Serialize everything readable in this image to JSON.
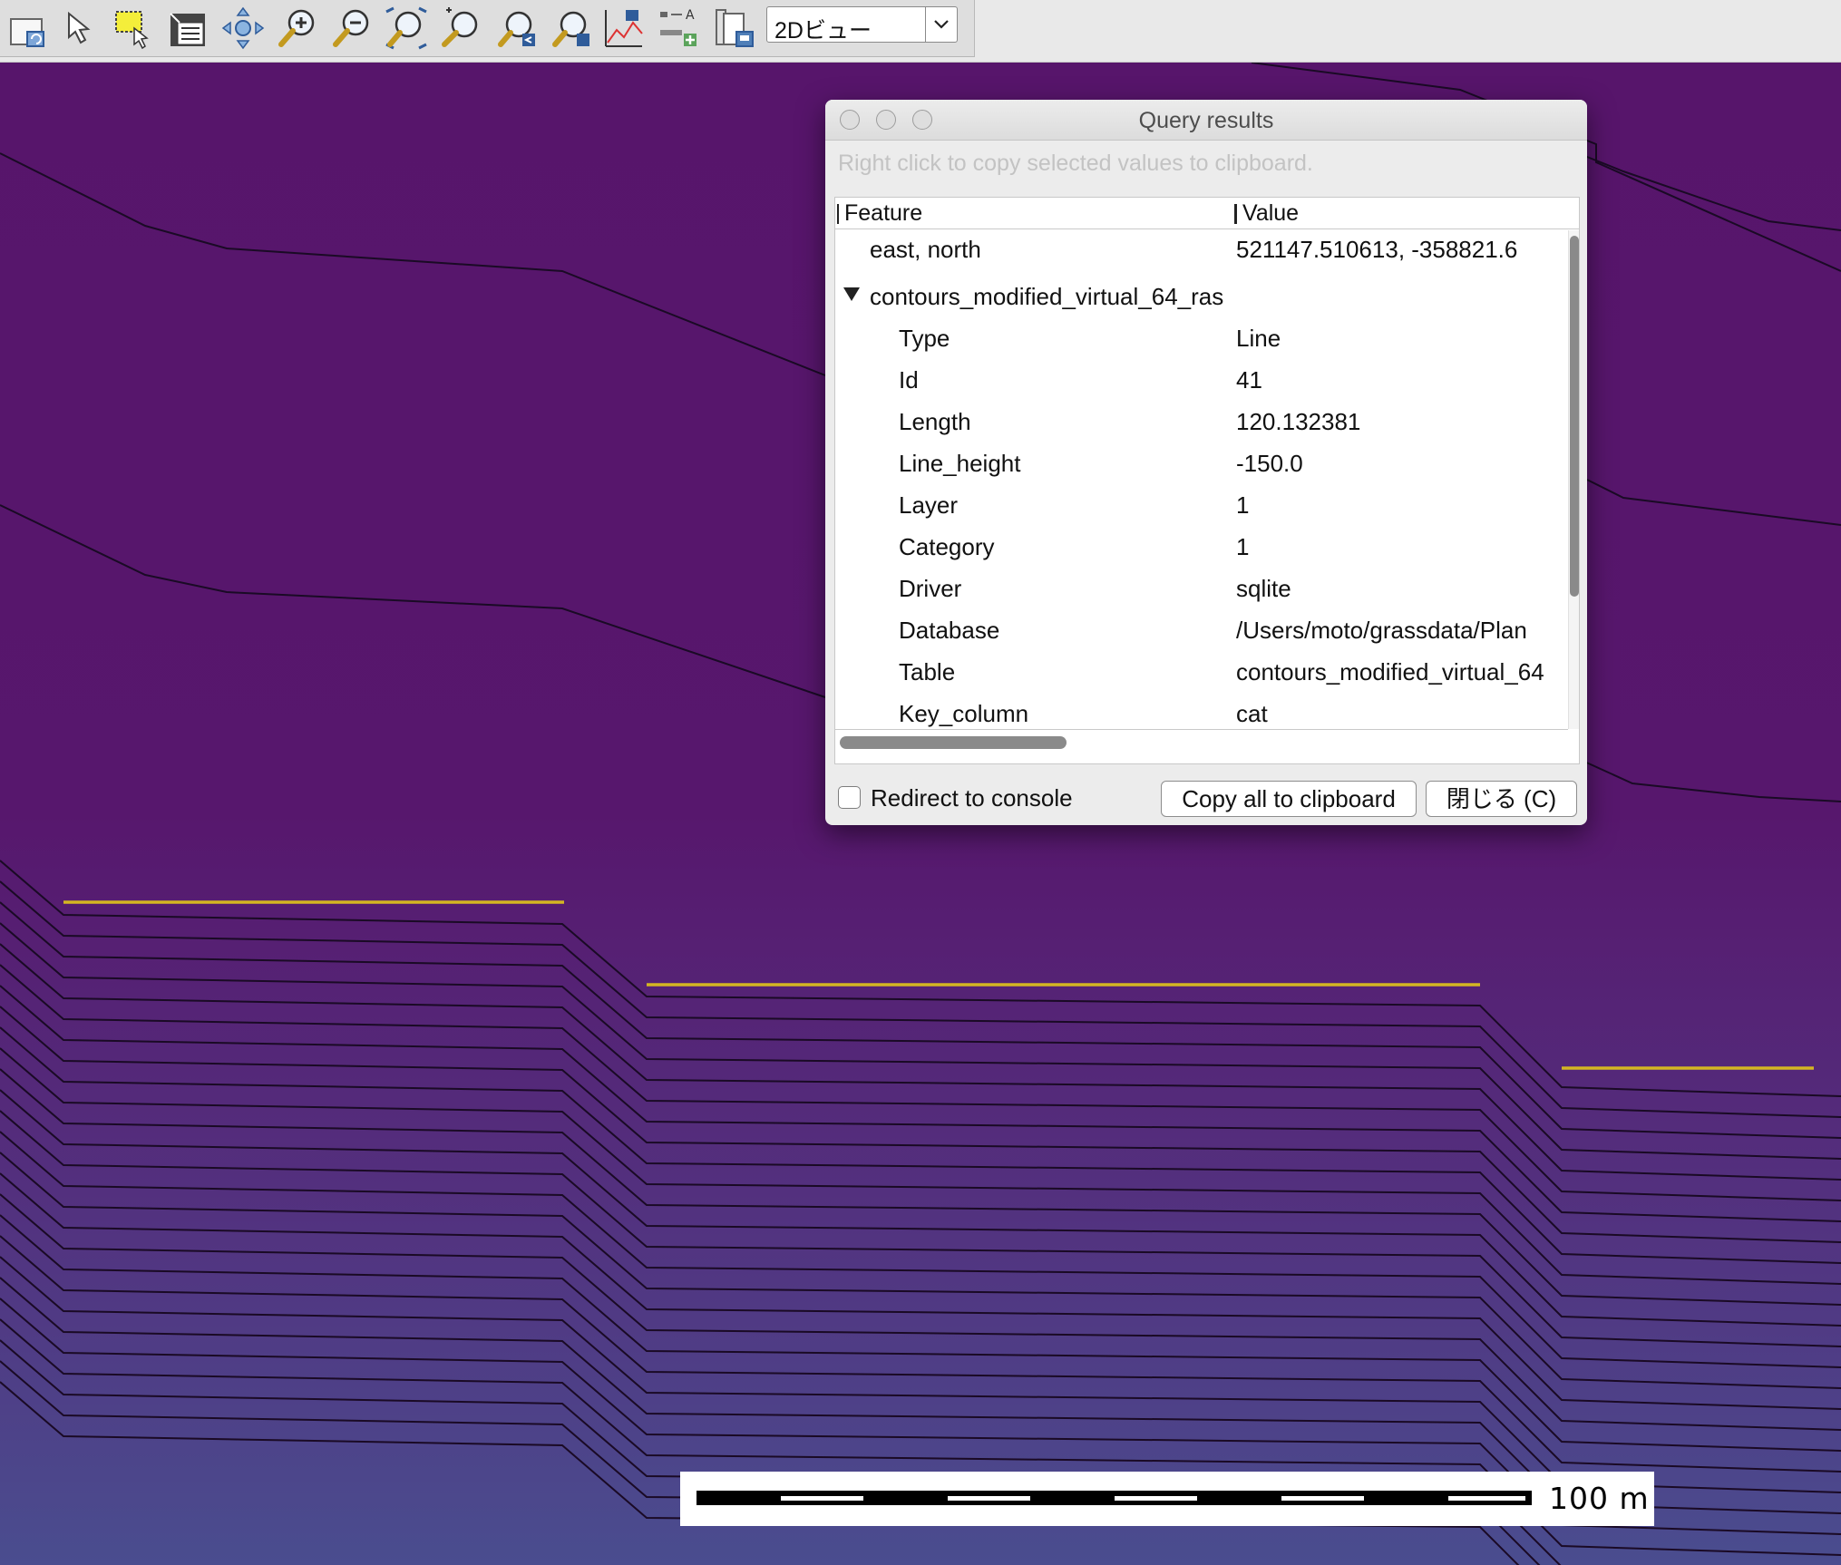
{
  "toolbar": {
    "tools": [
      {
        "name": "display-map-icon"
      },
      {
        "name": "pointer-icon"
      },
      {
        "name": "select-features-icon"
      },
      {
        "name": "query-raster-vector-icon"
      },
      {
        "name": "pan-icon"
      },
      {
        "name": "zoom-in-icon"
      },
      {
        "name": "zoom-out-icon"
      },
      {
        "name": "zoom-to-selected-icon"
      },
      {
        "name": "zoom-back-icon"
      },
      {
        "name": "zoom-options-icon"
      },
      {
        "name": "zoom-previous-icon"
      },
      {
        "name": "analyze-map-icon"
      },
      {
        "name": "map-elements-icon"
      },
      {
        "name": "save-display-icon"
      }
    ],
    "view_select": {
      "value": "2Dビュー"
    }
  },
  "dialog": {
    "title": "Query results",
    "hint": "Right click to copy selected values to clipboard.",
    "columns": {
      "feature": "Feature",
      "value": "Value"
    },
    "coordinates": {
      "label": "east, north",
      "value": "521147.510613, -358821.6"
    },
    "layer_name": "contours_modified_virtual_64_ras",
    "attributes": [
      {
        "feature": "Type",
        "value": "Line"
      },
      {
        "feature": "Id",
        "value": "41"
      },
      {
        "feature": "Length",
        "value": "120.132381"
      },
      {
        "feature": "Line_height",
        "value": "-150.0"
      },
      {
        "feature": "Layer",
        "value": "1"
      },
      {
        "feature": "Category",
        "value": "1"
      },
      {
        "feature": "Driver",
        "value": "sqlite"
      },
      {
        "feature": "Database",
        "value": "/Users/moto/grassdata/Plan"
      },
      {
        "feature": "Table",
        "value": "contours_modified_virtual_64"
      },
      {
        "feature": "Key_column",
        "value": "cat"
      }
    ],
    "redirect_label": "Redirect to console",
    "redirect_checked": false,
    "copy_button": "Copy all to clipboard",
    "close_button": "閉じる (C)"
  },
  "map": {
    "scale_label": "100 m",
    "colors": {
      "top": "#57156b",
      "bottom": "#4a4b8e",
      "contour": "#1a0a25",
      "highlight": "#d4b622"
    }
  }
}
